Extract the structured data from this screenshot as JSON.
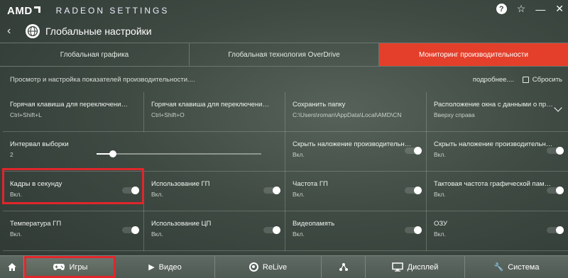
{
  "app": {
    "logo": "AMD",
    "title": "RADEON SETTINGS",
    "help_icon": "help-icon",
    "favorite_icon": "star-icon",
    "minimize_icon": "minimize-icon",
    "close_icon": "close-icon"
  },
  "header": {
    "back_icon": "back-icon",
    "globe_icon": "globe-icon",
    "title": "Глобальные настройки"
  },
  "tabs": [
    {
      "label": "Глобальная графика",
      "active": false
    },
    {
      "label": "Глобальная технология OverDrive",
      "active": false
    },
    {
      "label": "Мониторинг производительности",
      "active": true
    }
  ],
  "info": {
    "description": "Просмотр и настройка показателей производительности....",
    "more_link": "подробнее....",
    "reset_label": "Сбросить"
  },
  "grid": {
    "row1": [
      {
        "label": "Горячая клавиша для переключения ...",
        "value": "Ctrl+Shift+L"
      },
      {
        "label": "Горячая клавиша для переключения ...",
        "value": "Ctrl+Shift+O"
      },
      {
        "label": "Сохранить папку",
        "value": "C:\\Users\\roman\\AppData\\Local\\AMD\\CN"
      },
      {
        "label": "Расположение окна с данными о прои...",
        "value": "Вверху справа"
      }
    ],
    "row2": [
      {
        "label": "Интервал выборки",
        "value": "2",
        "slider_fraction": 0.1
      },
      {
        "label": "Скрыть наложение производительност...",
        "value": "Вкл.",
        "toggle": true
      },
      {
        "label": "Скрыть наложение производительност...",
        "value": "Вкл.",
        "toggle": true
      }
    ],
    "row3": [
      {
        "label": "Кадры в секунду",
        "value": "Вкл.",
        "toggle": true
      },
      {
        "label": "Использование ГП",
        "value": "Вкл.",
        "toggle": true
      },
      {
        "label": "Частота ГП",
        "value": "Вкл.",
        "toggle": true
      },
      {
        "label": "Тактовая частота графической памяти",
        "value": "Вкл.",
        "toggle": true
      }
    ],
    "row4": [
      {
        "label": "Температура ГП",
        "value": "Вкл.",
        "toggle": true
      },
      {
        "label": "Использование ЦП",
        "value": "Вкл.",
        "toggle": true
      },
      {
        "label": "Видеопамять",
        "value": "Вкл.",
        "toggle": true
      },
      {
        "label": "ОЗУ",
        "value": "Вкл.",
        "toggle": true
      }
    ]
  },
  "bottom_nav": {
    "home_icon": "home-icon",
    "games": "Игры",
    "video": "Видео",
    "relive": "ReLive",
    "connect_icon": "connect-icon",
    "display": "Дисплей",
    "system": "Система"
  },
  "colors": {
    "accent": "#e43f2a",
    "highlight": "#e0262b"
  }
}
